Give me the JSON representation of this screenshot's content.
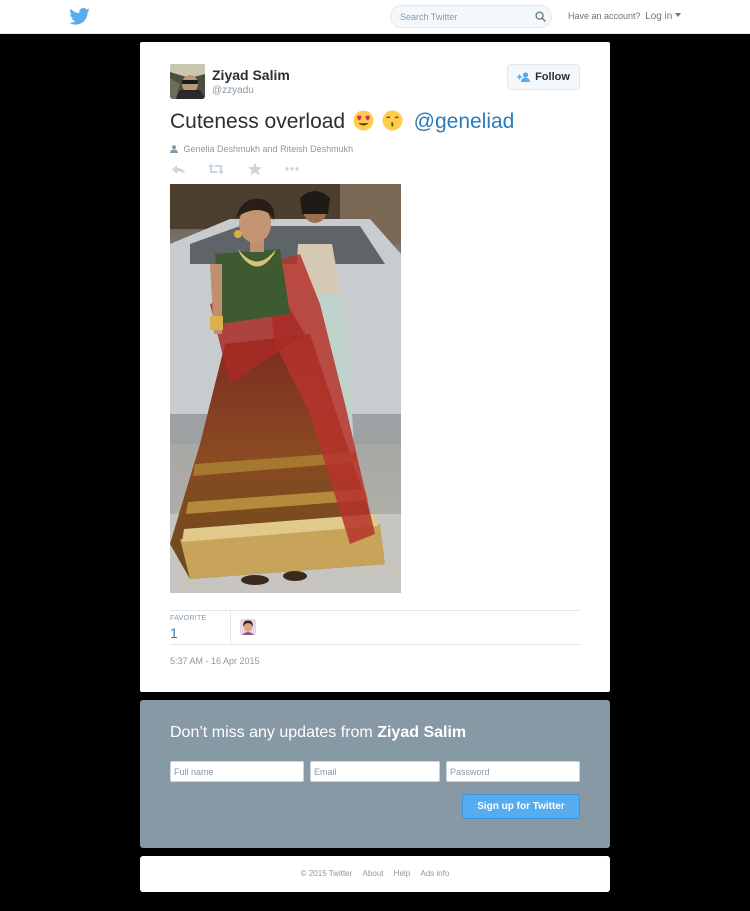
{
  "header": {
    "logo_icon": "twitter-bird-icon",
    "search_placeholder": "Search Twitter",
    "account_prompt": "Have an account?",
    "login_label": "Log in"
  },
  "tweet": {
    "author_name": "Ziyad Salim",
    "author_handle": "@zzyadu",
    "follow_label": "Follow",
    "text": "Cuteness overload",
    "emojis": [
      "heart-eyes-emoji",
      "kissing-emoji"
    ],
    "mention": "@geneliad",
    "tagged_people": "Genelia Deshmukh and Riteish Deshmukh",
    "action_icons": [
      "reply-icon",
      "retweet-icon",
      "favorite-icon",
      "more-icon"
    ],
    "favorite_label": "FAVORITE",
    "favorite_count": "1",
    "timestamp": "5:37 AM - 16 Apr 2015"
  },
  "signup": {
    "title_prefix": "Don’t miss any updates from",
    "title_name": "Ziyad Salim",
    "fullname_placeholder": "Full name",
    "email_placeholder": "Email",
    "password_placeholder": "Password",
    "button_label": "Sign up for Twitter"
  },
  "footer": {
    "copyright": "© 2015 Twitter",
    "about": "About",
    "help": "Help",
    "ads_info": "Ads info"
  },
  "colors": {
    "twitter_blue": "#55acee",
    "link_blue": "#2b7bb9",
    "signup_bg": "#8899a6",
    "page_bg": "#000000"
  }
}
